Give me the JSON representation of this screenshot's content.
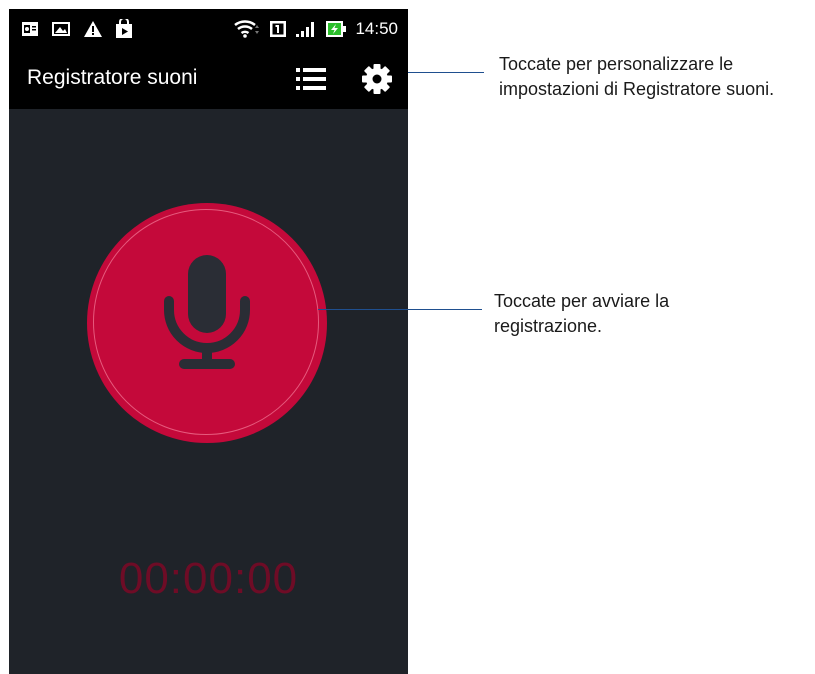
{
  "status_bar": {
    "icons": [
      "outlook-icon",
      "image-icon",
      "warning-icon",
      "play-store-icon",
      "wifi-icon",
      "sim-icon",
      "signal-icon",
      "battery-charging-icon"
    ],
    "time": "14:50"
  },
  "app_bar": {
    "title": "Registratore suoni",
    "icons": [
      "list-icon",
      "gear-icon"
    ]
  },
  "recorder": {
    "button_icon": "microphone-icon",
    "timer": "00:00:00",
    "accent_color": "#c4093a"
  },
  "annotations": {
    "settings": {
      "line1": "Toccate per personalizzare le",
      "line2": "impostazioni di Registratore suoni."
    },
    "record": {
      "line1": "Toccate per avviare la",
      "line2": "registrazione."
    }
  }
}
